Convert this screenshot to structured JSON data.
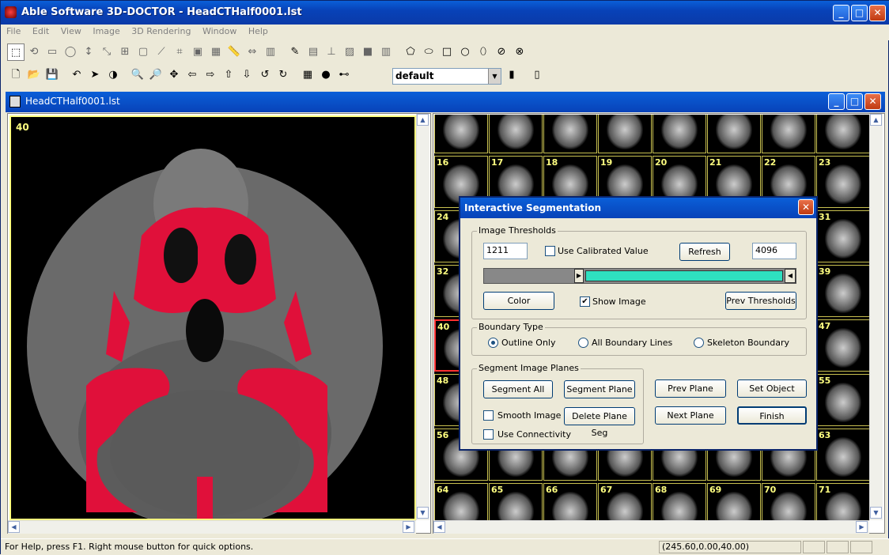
{
  "app": {
    "title": "Able Software 3D-DOCTOR - HeadCTHalf0001.lst",
    "min": "_",
    "max": "□",
    "close": "✕"
  },
  "menu": [
    "File",
    "Edit",
    "View",
    "Image",
    "3D Rendering",
    "Window",
    "Help"
  ],
  "toolbar": {
    "row1_icons": [
      "select-rect-icon",
      "lasso-icon",
      "rectangle-icon",
      "ellipse-icon",
      "vertical-measure-icon",
      "polyline-icon",
      "grid-icon",
      "square-icon",
      "diagonal-icon",
      "crop-icon",
      "frame-icon",
      "tile-icon",
      "ruler-icon",
      "calibrate-icon",
      "histogram-icon",
      "pencil-icon",
      "stamp-icon",
      "pin-icon",
      "image-icon",
      "fill-icon",
      "chart-icon",
      "polygon-select-icon",
      "freehand-icon",
      "square-tool-icon",
      "circle-icon",
      "blob-icon",
      "erase-blob-icon",
      "delete-icon"
    ],
    "row2_icons": [
      "new-icon",
      "open-icon",
      "save-icon",
      "undo-icon",
      "pointer-icon",
      "contrast-icon",
      "zoom-in-icon",
      "zoom-out-icon",
      "fit-icon",
      "prev-icon",
      "next-icon",
      "up-icon",
      "down-icon",
      "rotate-left-icon",
      "rotate-right-icon",
      "snapshot-icon",
      "record-icon",
      "line-icon",
      "phone-icon",
      "tablet-icon"
    ],
    "combo_value": "default"
  },
  "child_window": {
    "title": "HeadCTHalf0001.lst",
    "left_slice_number": "40"
  },
  "thumbs": {
    "row0": [
      "",
      "",
      "",
      "",
      "",
      "",
      "",
      ""
    ],
    "row1": [
      "16",
      "17",
      "18",
      "19",
      "20",
      "21",
      "22",
      "23"
    ],
    "row2": [
      "24",
      "",
      "",
      "",
      "",
      "",
      "",
      "31"
    ],
    "row3": [
      "32",
      "",
      "",
      "",
      "",
      "",
      "",
      "39"
    ],
    "row4": [
      "40",
      "",
      "",
      "",
      "",
      "",
      "",
      "47"
    ],
    "row5": [
      "48",
      "",
      "",
      "",
      "",
      "",
      "",
      "55"
    ],
    "row6": [
      "56",
      "",
      "",
      "",
      "",
      "",
      "",
      "63"
    ],
    "row7": [
      "64",
      "65",
      "66",
      "67",
      "68",
      "69",
      "70",
      "71"
    ]
  },
  "dialog": {
    "title": "Interactive Segmentation",
    "thresholds_label": "Image Thresholds",
    "min_value": "1211",
    "use_calibrated_label": "Use Calibrated Value",
    "use_calibrated_checked": false,
    "refresh_label": "Refresh",
    "max_value": "4096",
    "slider_color": "#2fe0c0",
    "slider_min_fraction": 0.3,
    "color_label": "Color",
    "show_image_label": "Show Image",
    "show_image_checked": true,
    "prev_thresholds_label": "Prev Thresholds",
    "boundary_type_label": "Boundary Type",
    "outline_only_label": "Outline Only",
    "all_boundary_label": "All Boundary Lines",
    "skeleton_label": "Skeleton Boundary",
    "selected_boundary": "Outline Only",
    "segment_planes_label": "Segment Image Planes",
    "segment_all_label": "Segment All",
    "segment_plane_label": "Segment Plane",
    "smooth_image_label": "Smooth Image",
    "delete_plane_seg_label": "Delete Plane Seg",
    "use_connectivity_label": "Use Connectivity",
    "prev_plane_label": "Prev Plane",
    "set_object_label": "Set Object",
    "next_plane_label": "Next Plane",
    "finish_label": "Finish"
  },
  "status": {
    "help_text": "For Help, press F1. Right mouse button for quick options.",
    "coords": "(245.60,0.00,40.00)"
  },
  "colors": {
    "segmentation": "#e0103a",
    "titlebar": "#0842b8"
  }
}
